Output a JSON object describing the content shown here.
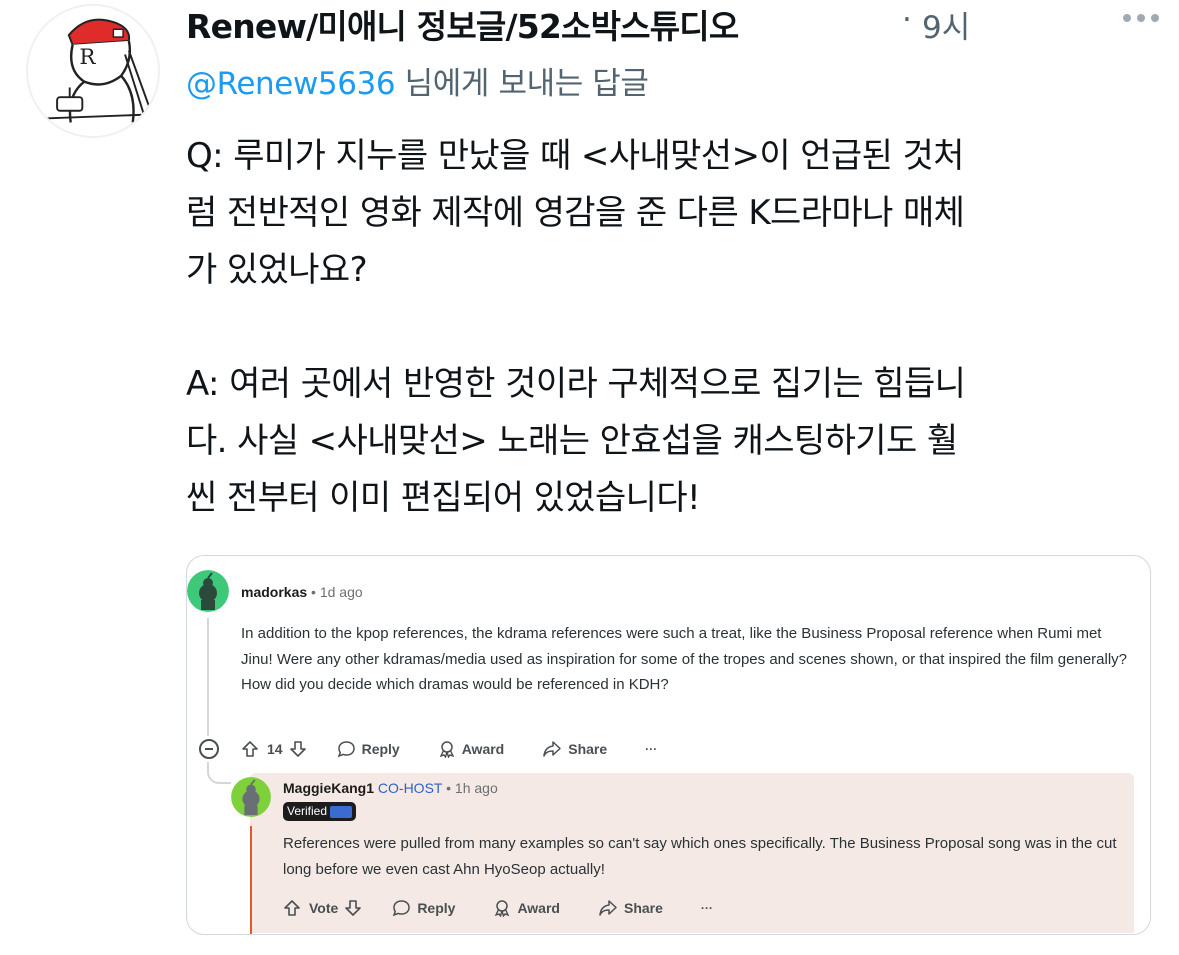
{
  "tweet": {
    "display_name": "Renew/미애니 정보글/52소박스튜디오",
    "separator": "·",
    "time": "9시",
    "reply_to_handle": "@Renew5636",
    "reply_to_suffix": "님에게 보내는 답글",
    "body": {
      "q_lines": [
        "Q: 루미가 지누를 만났을 때 <사내맞선>이 언급된 것처",
        "럼 전반적인 영화 제작에 영감을 준 다른 K드라마나 매체",
        "가 있었나요?"
      ],
      "a_lines": [
        "A: 여러 곳에서 반영한 것이라 구체적으로 집기는 힘듭니",
        "다. 사실 <사내맞선> 노래는 안효섭을 캐스팅하기도 훨",
        "씬 전부터 이미 편집되어 있었습니다!"
      ]
    }
  },
  "embed": {
    "comment": {
      "username": "madorkas",
      "separator": "•",
      "age": "1d ago",
      "text": "In addition to the kpop references, the kdrama references were such a treat, like the Business Proposal reference when Rumi met Jinu! Were any other kdramas/media used as inspiration for some of the tropes and scenes shown, or that inspired the film generally? How did you decide which dramas would be referenced in KDH?",
      "votes": "14",
      "reply_label": "Reply",
      "award_label": "Award",
      "share_label": "Share",
      "more_label": "···"
    },
    "reply": {
      "username": "MaggieKang1",
      "flair": "CO-HOST",
      "separator": "•",
      "age": "1h ago",
      "badge": "Verified",
      "text": "References were pulled from many examples so can't say which ones specifically. The Business Proposal song was in the cut long before we even cast Ahn HyoSeop actually!",
      "vote_label": "Vote",
      "reply_label": "Reply",
      "award_label": "Award",
      "share_label": "Share",
      "more_label": "···"
    }
  },
  "colors": {
    "link_blue": "#1d9bf0",
    "secondary_text": "#536471",
    "reddit_avatar_green": "#3ec97a",
    "reply_background": "#f4e9e4",
    "reply_accent": "#e5562c",
    "cohost_blue": "#2a63c8"
  },
  "icons": [
    "more-icon",
    "upvote-icon",
    "downvote-icon",
    "comment-icon",
    "award-icon",
    "share-icon",
    "collapse-icon"
  ]
}
